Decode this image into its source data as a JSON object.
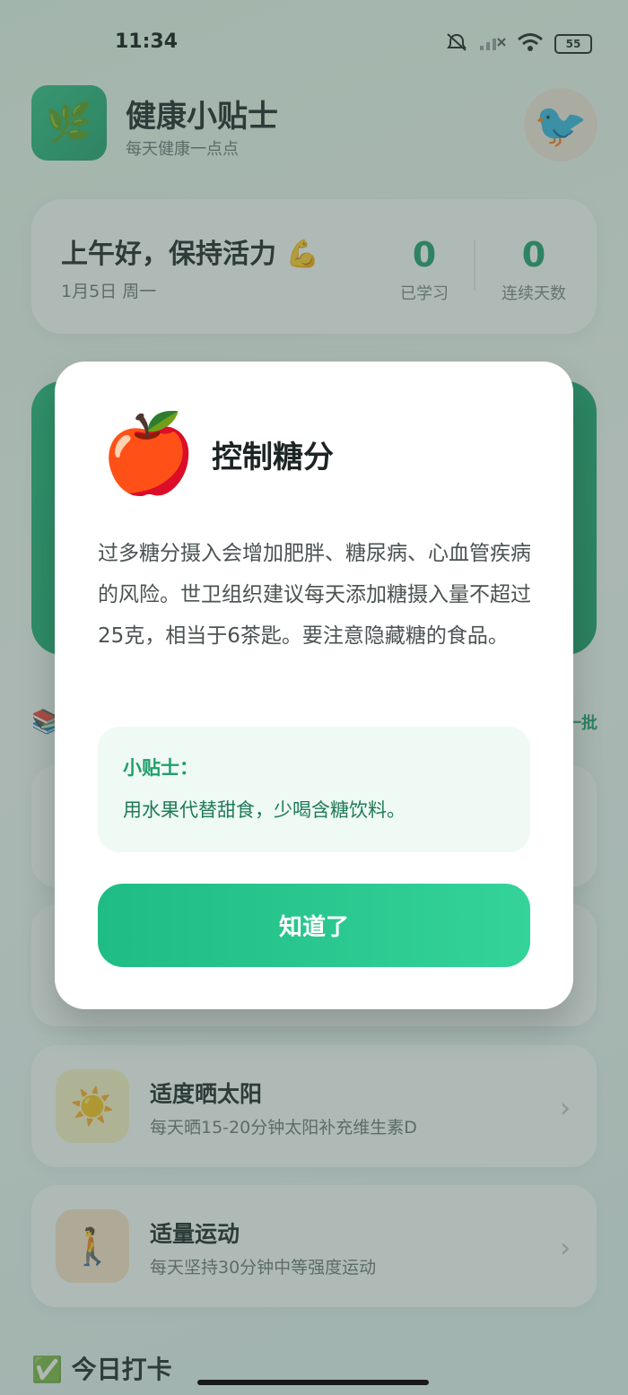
{
  "status_bar": {
    "time": "11:34",
    "battery": "55"
  },
  "header": {
    "title": "健康小贴士",
    "subtitle": "每天健康一点点",
    "logo_icon": "leaf-icon",
    "avatar_icon": "bird-avatar"
  },
  "greeting": {
    "title": "上午好，保持活力 💪",
    "date": "1月5日 周一",
    "stats": [
      {
        "value": "0",
        "label": "已学习"
      },
      {
        "value": "0",
        "label": "连续天数"
      }
    ]
  },
  "section": {
    "icon": "books-icon",
    "right_text": "换一批"
  },
  "list": [
    {
      "icon": "☀️",
      "icon_name": "sun-icon",
      "title": "适度晒太阳",
      "desc": "每天晒15-20分钟太阳补充维生素D"
    },
    {
      "icon": "🚶",
      "icon_name": "walking-icon",
      "title": "适量运动",
      "desc": "每天坚持30分钟中等强度运动"
    }
  ],
  "checkin": {
    "title": "今日打卡"
  },
  "modal": {
    "emoji": "🍎",
    "title": "控制糖分",
    "body": "过多糖分摄入会增加肥胖、糖尿病、心血管疾病的风险。世卫组织建议每天添加糖摄入量不超过25克，相当于6茶匙。要注意隐藏糖的食品。",
    "tip_title": "小贴士：",
    "tip_text": "用水果代替甜食，少喝含糖饮料。",
    "button": "知道了"
  },
  "colors": {
    "brand": "#1f9e6c",
    "button_start": "#1fbc85",
    "button_end": "#34d399",
    "tip_bg": "#eefaf3"
  }
}
